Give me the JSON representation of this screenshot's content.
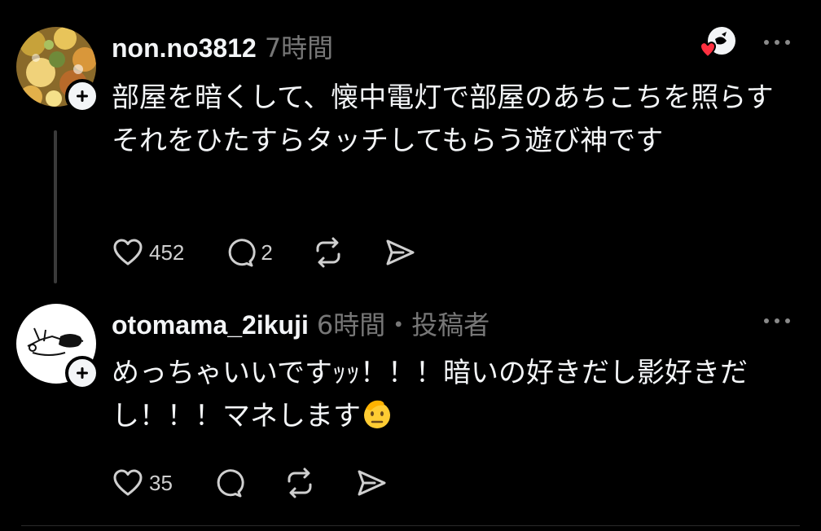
{
  "posts": [
    {
      "username": "non.no3812",
      "meta": "7時間",
      "body": "部屋を暗くして、懐中電灯で部屋のあちこちを照らす\nそれをひたすらタッチしてもらう遊び神です",
      "likes": "452",
      "replies": "2"
    },
    {
      "username": "otomama_2ikuji",
      "meta": "6時間・投稿者",
      "body": "めっちゃいいですｯｯ！！！暗いの好きだし影好きだし！！！マネします",
      "body_emoji": "saluting-face",
      "likes": "35"
    }
  ],
  "icons": {
    "like": "heart-icon",
    "reply": "comment-icon",
    "repost": "repost-icon",
    "share": "send-icon",
    "more": "more-dots-icon",
    "follow": "plus-icon",
    "reaction": "author-liked-badge"
  },
  "colors": {
    "background": "#000000",
    "text": "#f3f5f7",
    "secondary": "#777777",
    "heart": "#ff3040"
  }
}
